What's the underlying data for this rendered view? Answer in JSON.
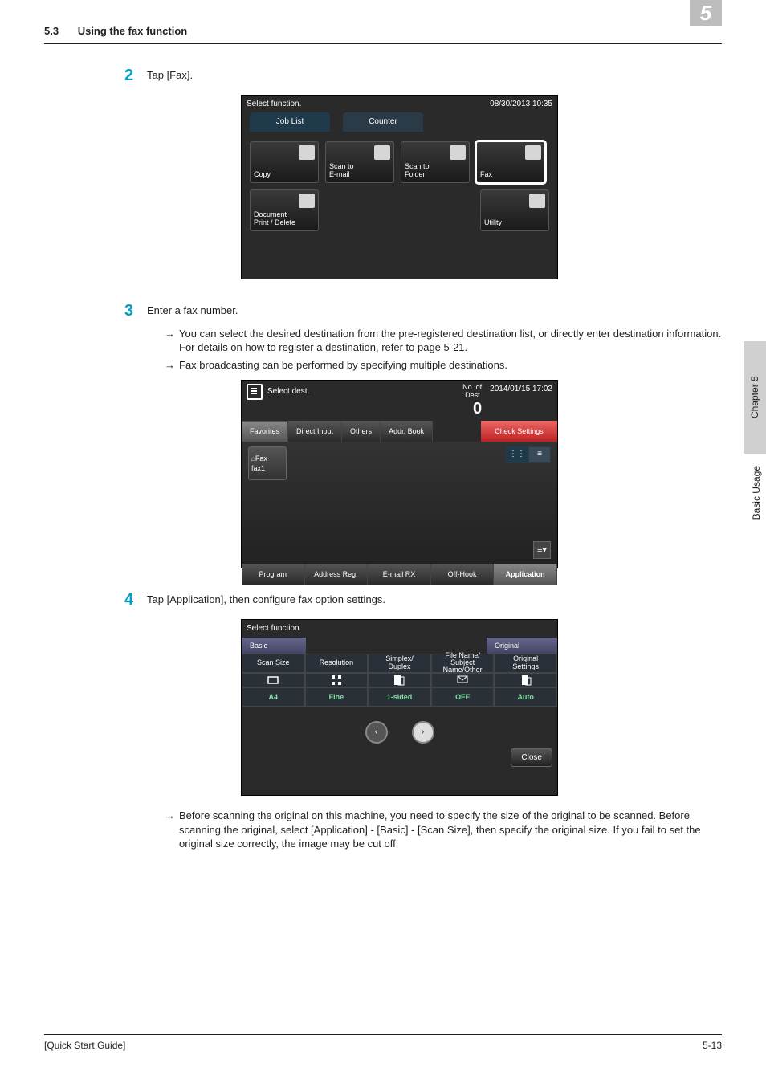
{
  "chapter_box": "5",
  "header": {
    "section_num": "5.3",
    "section_title": "Using the fax function"
  },
  "side_tab": "Chapter 5",
  "side_label": "Basic Usage",
  "steps": {
    "s2": {
      "num": "2",
      "text": "Tap [Fax]."
    },
    "s3": {
      "num": "3",
      "text": "Enter a fax number.",
      "sub1": "You can select the desired destination from the pre-registered destination list, or directly enter destination information. For details on how to register a destination, refer to page 5-21.",
      "sub2": "Fax broadcasting can be performed by specifying multiple destinations."
    },
    "s4": {
      "num": "4",
      "text": "Tap [Application], then configure fax option settings.",
      "sub1": "Before scanning the original on this machine, you need to specify the size of the original to be scanned. Before scanning the original, select [Application] - [Basic] - [Scan Size], then specify the original size. If you fail to set the original size correctly, the image may be cut off."
    }
  },
  "shot1": {
    "title": "Select function.",
    "datetime": "08/30/2013 10:35",
    "tab1": "Job List",
    "tab2": "Counter",
    "tile_copy": "Copy",
    "tile_scan_email": "Scan to\nE-mail",
    "tile_scan_folder": "Scan to\nFolder",
    "tile_fax": "Fax",
    "tile_doc": "Document\nPrint / Delete",
    "tile_utility": "Utility"
  },
  "shot2": {
    "title": "Select dest.",
    "dest_label": "No. of\nDest.",
    "dest_count": "0",
    "datetime": "2014/01/15 17:02",
    "tab_fav": "Favorites",
    "tab_direct": "Direct Input",
    "tab_others": "Others",
    "tab_addr": "Addr. Book",
    "check_settings": "Check Settings",
    "fav_line1": "Fax",
    "fav_line2": "fax1",
    "bottom": {
      "program": "Program",
      "address_reg": "Address Reg.",
      "email_rx": "E-mail RX",
      "off_hook": "Off-Hook",
      "application": "Application"
    }
  },
  "shot3": {
    "title": "Select function.",
    "section_basic": "Basic",
    "section_original": "Original",
    "headers": {
      "scan_size": "Scan Size",
      "resolution": "Resolution",
      "duplex": "Simplex/\nDuplex",
      "file_name": "File Name/\nSubject\nName/Other",
      "orig_settings": "Original\nSettings"
    },
    "values": {
      "scan_size": "A4",
      "resolution": "Fine",
      "duplex": "1-sided",
      "file_name": "OFF",
      "orig_settings": "Auto"
    },
    "close": "Close"
  },
  "footer": {
    "left": "[Quick Start Guide]",
    "right": "5-13"
  }
}
